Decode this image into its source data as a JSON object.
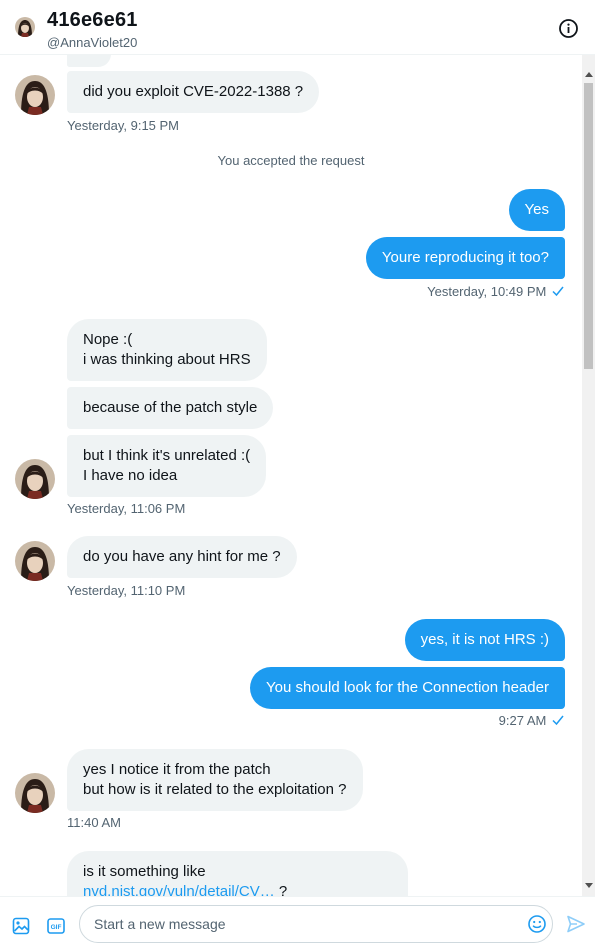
{
  "header": {
    "name": "416e6e61",
    "handle": "@AnnaViolet20"
  },
  "notice": "You accepted the request",
  "messages": [
    {
      "text": "did you exploit CVE-2022-1388 ?"
    },
    {
      "text": "Yes"
    },
    {
      "text": "Youre reproducing it too?"
    },
    {
      "text_line1": "Nope :(",
      "text_line2": "i was thinking about HRS"
    },
    {
      "text": "because of the patch style"
    },
    {
      "text_line1": "but I think it's unrelated :(",
      "text_line2": "I have no idea"
    },
    {
      "text": "do you have any hint for me ?"
    },
    {
      "text": "yes, it is not HRS :)"
    },
    {
      "text": "You should look for the Connection header"
    },
    {
      "text_line1": "yes I notice it from the patch",
      "text_line2": "but how is it related to the exploitation ?"
    },
    {
      "text_line1": "is it something like",
      "link": "nvd.nist.gov/vuln/detail/CV…",
      "after_link": " ?"
    }
  ],
  "timestamps": {
    "t1": "Yesterday, 9:15 PM",
    "t2": "Yesterday, 10:49 PM",
    "t3": "Yesterday, 11:06 PM",
    "t4": "Yesterday, 11:10 PM",
    "t5": "9:27 AM",
    "t6": "11:40 AM"
  },
  "composer": {
    "placeholder": "Start a new message"
  },
  "colors": {
    "accent": "#1d9bf0",
    "incoming_bubble": "#eff3f4",
    "secondary_text": "#536471"
  },
  "icons": [
    "info-icon",
    "image-icon",
    "gif-icon",
    "emoji-icon",
    "send-icon",
    "read-check-icon"
  ]
}
